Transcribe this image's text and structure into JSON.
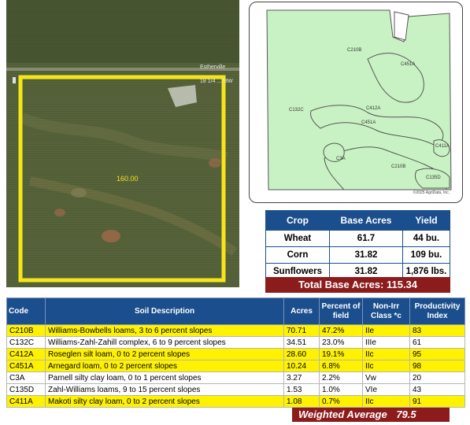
{
  "aerial_map": {
    "road_label_top": "Estherville",
    "road_label_right": "18 1/4 ...78W",
    "field_acres": "160.00"
  },
  "soil_map": {
    "labels": [
      "C210B",
      "C451A",
      "C132C",
      "C412A",
      "C451A",
      "C3A",
      "C210B",
      "C411A",
      "C135D"
    ],
    "copyright": "©2025 AgriData, Inc."
  },
  "crop_table": {
    "headers": [
      "Crop",
      "Base Acres",
      "Yield"
    ],
    "rows": [
      {
        "crop": "Wheat",
        "base_acres": "61.7",
        "yield": "44 bu."
      },
      {
        "crop": "Corn",
        "base_acres": "31.82",
        "yield": "109 bu."
      },
      {
        "crop": "Sunflowers",
        "base_acres": "31.82",
        "yield": "1,876 lbs."
      }
    ],
    "total_label": "Total Base Acres: 115.34"
  },
  "soil_table": {
    "headers": [
      "Code",
      "Soil Description",
      "Acres",
      "Percent of field",
      "Non-Irr Class *c",
      "Productivity Index"
    ],
    "rows": [
      {
        "code": "C210B",
        "desc": "Williams-Bowbells loams, 3 to 6 percent slopes",
        "acres": "70.71",
        "pct": "47.2%",
        "cls": "IIe",
        "pi": "83",
        "hl": true
      },
      {
        "code": "C132C",
        "desc": "Williams-Zahl-Zahill complex, 6 to 9 percent slopes",
        "acres": "34.51",
        "pct": "23.0%",
        "cls": "IIIe",
        "pi": "61",
        "hl": false
      },
      {
        "code": "C412A",
        "desc": "Roseglen silt loam, 0 to 2 percent slopes",
        "acres": "28.60",
        "pct": "19.1%",
        "cls": "IIc",
        "pi": "95",
        "hl": true
      },
      {
        "code": "C451A",
        "desc": "Arnegard loam, 0 to 2 percent slopes",
        "acres": "10.24",
        "pct": "6.8%",
        "cls": "IIc",
        "pi": "98",
        "hl": true
      },
      {
        "code": "C3A",
        "desc": "Parnell silty clay loam, 0 to 1 percent slopes",
        "acres": "3.27",
        "pct": "2.2%",
        "cls": "Vw",
        "pi": "20",
        "hl": false
      },
      {
        "code": "C135D",
        "desc": "Zahl-Williams loams, 9 to 15 percent slopes",
        "acres": "1.53",
        "pct": "1.0%",
        "cls": "VIe",
        "pi": "43",
        "hl": false
      },
      {
        "code": "C411A",
        "desc": "Makoti silty clay loam, 0 to 2 percent slopes",
        "acres": "1.08",
        "pct": "0.7%",
        "cls": "IIc",
        "pi": "91",
        "hl": true
      }
    ],
    "weighted_average_label": "Weighted Average",
    "weighted_average_value": "79.5"
  },
  "colors": {
    "header_blue": "#1a4e8c",
    "total_red": "#8c1c1c",
    "highlight_yellow": "#fff200",
    "map_green": "#c9f2c4",
    "field_outline_yellow": "#f5e61a"
  }
}
